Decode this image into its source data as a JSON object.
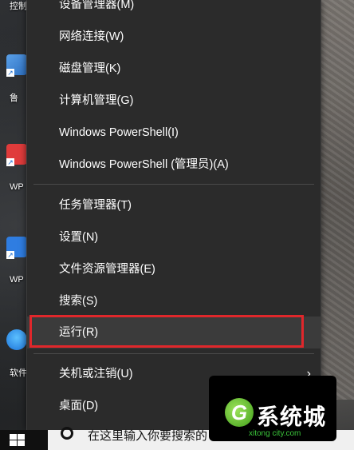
{
  "desktop": {
    "top_label": "控制",
    "icons": [
      {
        "label": "鲁"
      },
      {
        "label": "WP"
      },
      {
        "label": "WP"
      },
      {
        "label": "软件"
      }
    ]
  },
  "menu": {
    "items": [
      {
        "label": "设备管理器(M)"
      },
      {
        "label": "网络连接(W)"
      },
      {
        "label": "磁盘管理(K)"
      },
      {
        "label": "计算机管理(G)"
      },
      {
        "label": "Windows PowerShell(I)"
      },
      {
        "label": "Windows PowerShell (管理员)(A)"
      },
      {
        "label": "任务管理器(T)"
      },
      {
        "label": "设置(N)"
      },
      {
        "label": "文件资源管理器(E)"
      },
      {
        "label": "搜索(S)"
      },
      {
        "label": "运行(R)"
      },
      {
        "label": "关机或注销(U)"
      },
      {
        "label": "桌面(D)"
      }
    ],
    "chevron": "›"
  },
  "taskbar": {
    "search_placeholder": "在这里输入你要搜索的"
  },
  "watermark": {
    "logo_char": "G",
    "title": "系统城",
    "url": "xitong city.com"
  },
  "colors": {
    "menu_bg": "#2b2b2b",
    "highlight_border": "#e0272b",
    "text": "#ffffff"
  }
}
